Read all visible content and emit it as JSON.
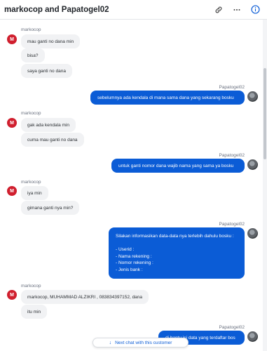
{
  "header": {
    "title": "markocop and Papatogel02",
    "icons": [
      "link-icon",
      "more-icon",
      "info-icon"
    ]
  },
  "messages": [
    {
      "direction": "in",
      "sender": "markocop",
      "avatar": "M",
      "bubbles": [
        "mau ganti no dana min",
        "bisa?",
        "saya ganti no dana"
      ]
    },
    {
      "direction": "out",
      "sender": "Papatogel02",
      "bubbles": [
        "sebelumnya ada kendala di mana sama dana yang sekarang bosku"
      ]
    },
    {
      "direction": "in",
      "sender": "markocop",
      "avatar": "M",
      "bubbles": [
        "gak ada kendala min",
        "cuma mau ganti no dana"
      ]
    },
    {
      "direction": "out",
      "sender": "Papatogel02",
      "bubbles": [
        "untuk ganti nomor dana wajib nama yang sama ya bosku"
      ]
    },
    {
      "direction": "in",
      "sender": "markocop",
      "avatar": "M",
      "bubbles": [
        "iya min",
        "gimana ganti nya min?"
      ]
    },
    {
      "direction": "out",
      "sender": "Papatogel02",
      "lines": [
        "Silakan informasikan data-data nya terlebih dahulu bosku :",
        "",
        "- Userid :",
        "- Nama rekening :",
        "- Nomor rekening :",
        "- Jenis bank :"
      ]
    },
    {
      "direction": "in",
      "sender": "markocop",
      "avatar": "M",
      "bubbles": [
        "markocop, MUHAMMAD ALZIKRI , 083834397152, dana",
        "itu min"
      ]
    },
    {
      "direction": "out",
      "sender": "Papatogel02",
      "bubbles": [
        "di bantu isi data yang terdaftar bos"
      ]
    }
  ],
  "next_chat_label": "Next chat with this customer"
}
